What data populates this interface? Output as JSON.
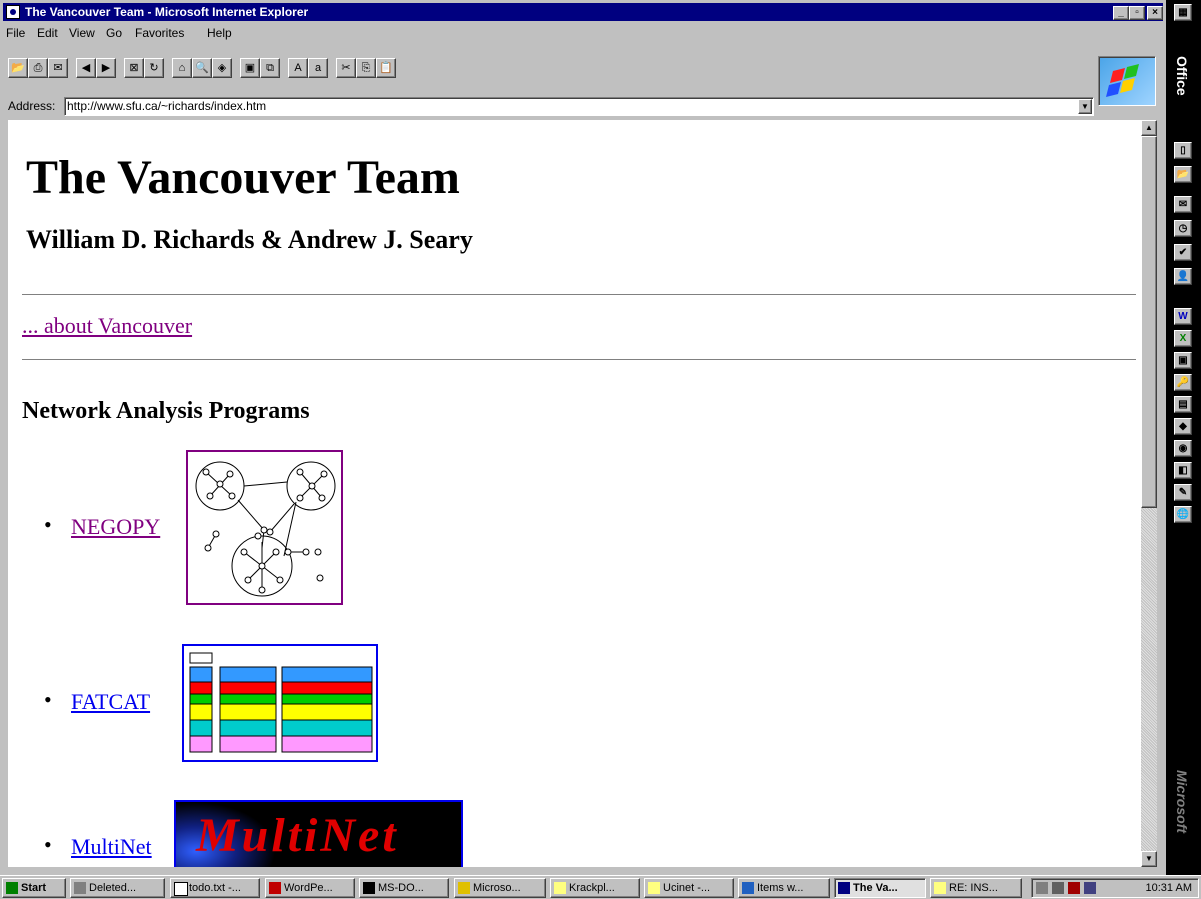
{
  "window": {
    "title": "The Vancouver Team - Microsoft Internet Explorer",
    "min": "_",
    "max": "▫",
    "close": "×"
  },
  "menu": [
    "File",
    "Edit",
    "View",
    "Go",
    "Favorites",
    "Help"
  ],
  "address": {
    "label": "Address:",
    "value": "http://www.sfu.ca/~richards/index.htm"
  },
  "page": {
    "title": "The Vancouver Team",
    "authors": "William D. Richards & Andrew J. Seary",
    "about_link": "... about Vancouver",
    "section_heading": "Network Analysis Programs",
    "programs": [
      {
        "label": "NEGOPY",
        "visited": true
      },
      {
        "label": "FATCAT",
        "visited": false
      },
      {
        "label": "MultiNet",
        "visited": false
      }
    ],
    "multinet_logo_text": "MultiNet"
  },
  "office": {
    "label": "Office",
    "brand": "Microsoft"
  },
  "taskbar": {
    "start": "Start",
    "tasks": [
      "Deleted...",
      "todo.txt -...",
      "WordPe...",
      "MS-DO...",
      "Microso...",
      "Krackpl...",
      "Ucinet -...",
      "Items w...",
      "The Va...",
      "RE: INS..."
    ],
    "active_task": "The Va...",
    "clock": "10:31 AM"
  },
  "colors": {
    "titlebar": "#000080",
    "link": "#0000ee",
    "visited": "#800080",
    "fatcat_blue": "#3399ff",
    "fatcat_red": "#ff0000",
    "fatcat_green": "#00cc00",
    "fatcat_yellow": "#ffff00",
    "fatcat_cyan": "#00cccc",
    "fatcat_pink": "#ff99ff"
  }
}
